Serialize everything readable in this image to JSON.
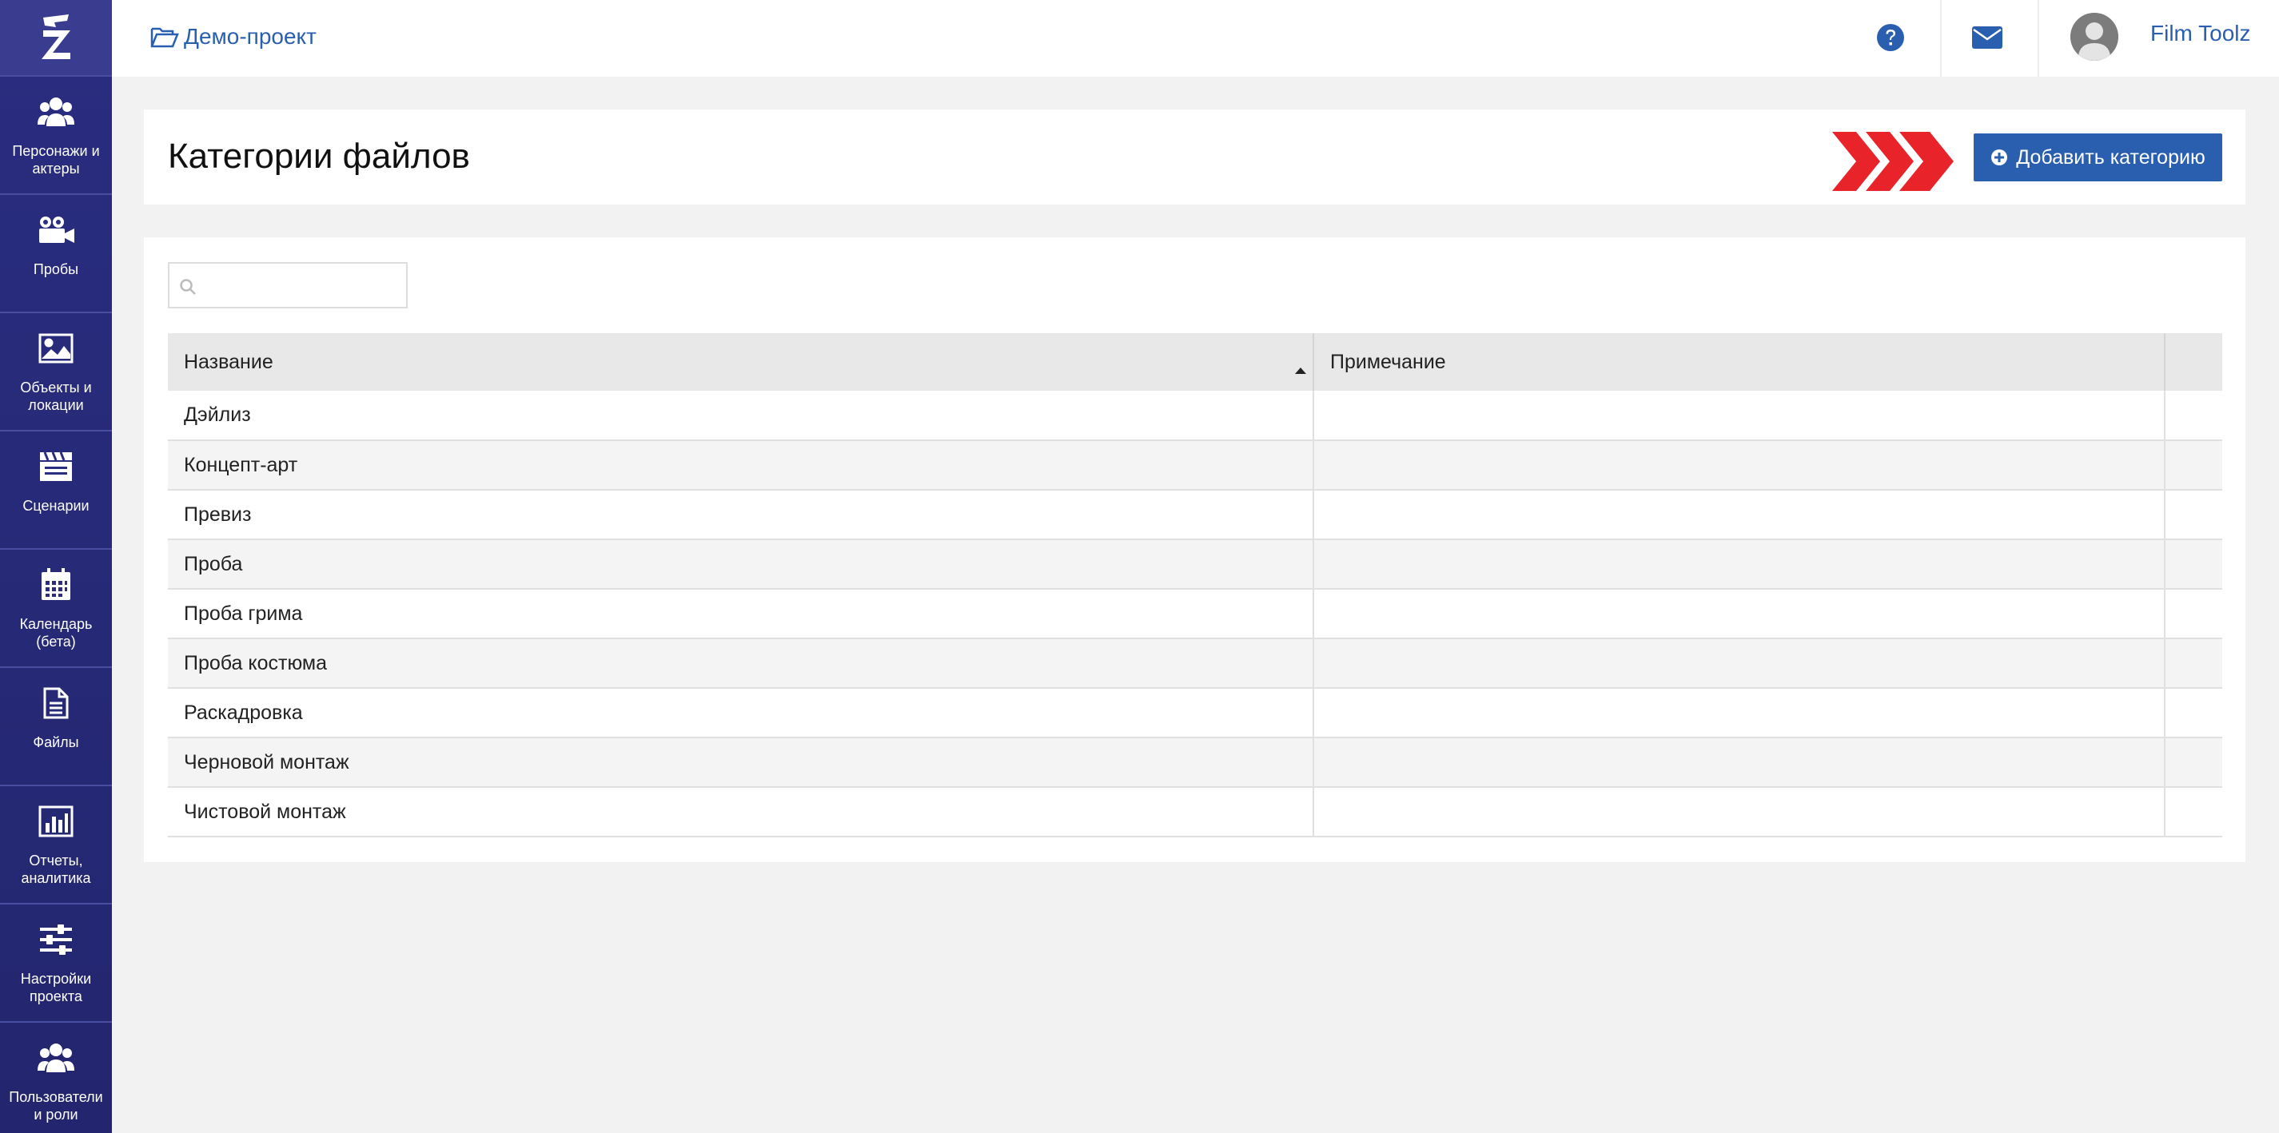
{
  "sidebar": {
    "items": [
      {
        "label": "Персонажи и актеры",
        "icon": "users-icon"
      },
      {
        "label": "Пробы",
        "icon": "video-camera-icon"
      },
      {
        "label": "Объекты и локации",
        "icon": "image-icon"
      },
      {
        "label": "Сценарии",
        "icon": "clapperboard-icon"
      },
      {
        "label": "Календарь (бета)",
        "icon": "calendar-icon"
      },
      {
        "label": "Файлы",
        "icon": "file-icon"
      },
      {
        "label": "Отчеты, аналитика",
        "icon": "bar-chart-icon"
      },
      {
        "label": "Настройки проекта",
        "icon": "sliders-icon"
      },
      {
        "label": "Пользователи и роли",
        "icon": "users-icon"
      }
    ]
  },
  "topbar": {
    "breadcrumb": "Демо-проект",
    "username": "Film Toolz"
  },
  "header": {
    "title": "Категории файлов",
    "add_button": "Добавить категорию"
  },
  "search": {
    "placeholder": ""
  },
  "table": {
    "columns": [
      "Название",
      "Примечание"
    ],
    "rows": [
      {
        "name": "Дэйлиз",
        "note": ""
      },
      {
        "name": "Концепт-арт",
        "note": ""
      },
      {
        "name": "Превиз",
        "note": ""
      },
      {
        "name": "Проба",
        "note": ""
      },
      {
        "name": "Проба грима",
        "note": ""
      },
      {
        "name": "Проба костюма",
        "note": ""
      },
      {
        "name": "Раскадровка",
        "note": ""
      },
      {
        "name": "Черновой монтаж",
        "note": ""
      },
      {
        "name": "Чистовой монтаж",
        "note": ""
      }
    ]
  },
  "colors": {
    "sidebar": "#2a2d80",
    "accent": "#2a5fb0",
    "chevron": "#e8232a"
  }
}
